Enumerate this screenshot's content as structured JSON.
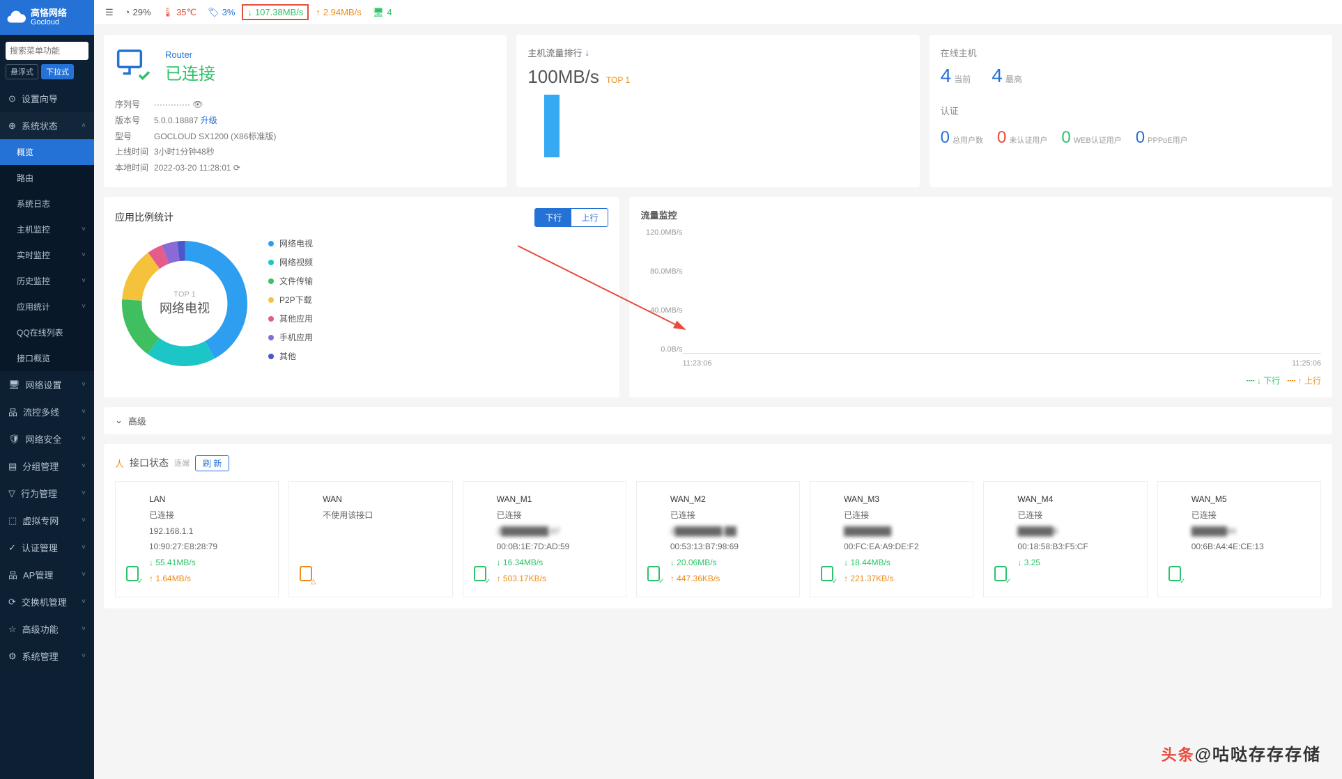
{
  "brand": {
    "name": "高恪网络",
    "sub": "Gocloud"
  },
  "search": {
    "placeholder": "搜索菜单功能"
  },
  "modes": {
    "float": "悬浮式",
    "dropdown": "下拉式"
  },
  "menu": {
    "setup": "设置向导",
    "status": "系统状态",
    "status_sub": {
      "overview": "概览",
      "route": "路由",
      "log": "系统日志",
      "host": "主机监控",
      "realtime": "实时监控",
      "history": "历史监控",
      "app": "应用统计",
      "qq": "QQ在线列表",
      "iface": "接口概览"
    },
    "network": "网络设置",
    "flowctl": "流控多线",
    "security": "网络安全",
    "group": "分组管理",
    "behavior": "行为管理",
    "vpn": "虚拟专网",
    "auth": "认证管理",
    "ap": "AP管理",
    "switch": "交换机管理",
    "advanced": "高级功能",
    "system": "系统管理"
  },
  "topbar": {
    "cpu": "29%",
    "temp": "35℃",
    "mem": "3%",
    "down": "107.38MB/s",
    "up": "2.94MB/s",
    "hosts": "4"
  },
  "router": {
    "label": "Router",
    "status": "已连接",
    "serial_k": "序列号",
    "serial_v": "·············",
    "ver_k": "版本号",
    "ver_v": "5.0.0.18887",
    "upgrade": "升级",
    "model_k": "型号",
    "model_v": "GOCLOUD SX1200 (X86标准版)",
    "uptime_k": "上线时间",
    "uptime_v": "3小时1分钟48秒",
    "local_k": "本地时间",
    "local_v": "2022-03-20 11:28:01"
  },
  "traffic": {
    "title": "主机流量排行",
    "value": "100MB/s",
    "top": "TOP 1"
  },
  "hosts": {
    "title": "在线主机",
    "now": "4",
    "now_t": "当前",
    "max": "4",
    "max_t": "最高",
    "auth_title": "认证",
    "items": [
      {
        "n": "0",
        "t": "总用户数",
        "c": "blue"
      },
      {
        "n": "0",
        "t": "未认证用户",
        "c": "red"
      },
      {
        "n": "0",
        "t": "WEB认证用户",
        "c": "green"
      },
      {
        "n": "0",
        "t": "PPPoE用户",
        "c": "blue"
      }
    ]
  },
  "appstats": {
    "title": "应用比例统计",
    "tab_down": "下行",
    "tab_up": "上行",
    "center_top": "TOP 1",
    "center_name": "网络电视",
    "legend": [
      {
        "c": "#2e9ef0",
        "t": "网络电视"
      },
      {
        "c": "#1cc6c6",
        "t": "网络视频"
      },
      {
        "c": "#3fbf5f",
        "t": "文件传输"
      },
      {
        "c": "#f5c33b",
        "t": "P2P下载"
      },
      {
        "c": "#e55b8a",
        "t": "其他应用"
      },
      {
        "c": "#8a6bd6",
        "t": "手机应用"
      },
      {
        "c": "#4a56c9",
        "t": "其他"
      }
    ]
  },
  "flow": {
    "title": "流量监控",
    "y": [
      "120.0MB/s",
      "80.0MB/s",
      "40.0MB/s",
      "0.0B/s"
    ],
    "x": [
      "11:23:06",
      "11:25:06"
    ],
    "legend_down": "下行",
    "legend_up": "上行"
  },
  "adv": {
    "title": "高级"
  },
  "iface": {
    "title": "接口状态",
    "sub": "逐端",
    "refresh": "刷 新",
    "cards": [
      {
        "name": "LAN",
        "status": "已连接",
        "ip": "192.168.1.1",
        "mac": "10:90:27:E8:28:79",
        "down": "55.41MB/s",
        "up": "1.64MB/s",
        "ok": true
      },
      {
        "name": "WAN",
        "status": "不使用该接口",
        "ok": false
      },
      {
        "name": "WAN_M1",
        "status": "已连接",
        "ip": "2████████.87",
        "mac": "00:0B:1E:7D:AD:59",
        "down": "16.34MB/s",
        "up": "503.17KB/s",
        "ok": true,
        "blur": true
      },
      {
        "name": "WAN_M2",
        "status": "已连接",
        "ip": "2████████.██",
        "mac": "00:53:13:B7:98:69",
        "down": "20.06MB/s",
        "up": "447.36KB/s",
        "ok": true,
        "blur": true
      },
      {
        "name": "WAN_M3",
        "status": "已连接",
        "ip": "████████",
        "mac": "00:FC:EA:A9:DE:F2",
        "down": "18.44MB/s",
        "up": "221.37KB/s",
        "ok": true,
        "blur": true
      },
      {
        "name": "WAN_M4",
        "status": "已连接",
        "ip": "██████8",
        "mac": "00:18:58:B3:F5:CF",
        "down": "3.25",
        "up": "",
        "ok": true,
        "blur": true
      },
      {
        "name": "WAN_M5",
        "status": "已连接",
        "ip": "██████84",
        "mac": "00:6B:A4:4E:CE:13",
        "down": "",
        "up": "",
        "ok": true,
        "blur": true
      }
    ]
  },
  "watermark": {
    "pre": "头条",
    "txt": "@咕哒存存存储"
  },
  "chart_data": {
    "donut": {
      "type": "pie",
      "title": "应用比例统计 · 下行",
      "center_label": "TOP 1 网络电视",
      "series": [
        {
          "name": "网络电视",
          "value": 42,
          "color": "#2e9ef0"
        },
        {
          "name": "网络视频",
          "value": 18,
          "color": "#1cc6c6"
        },
        {
          "name": "文件传输",
          "value": 16,
          "color": "#3fbf5f"
        },
        {
          "name": "P2P下载",
          "value": 14,
          "color": "#f5c33b"
        },
        {
          "name": "其他应用",
          "value": 4,
          "color": "#e55b8a"
        },
        {
          "name": "手机应用",
          "value": 4,
          "color": "#8a6bd6"
        },
        {
          "name": "其他",
          "value": 2,
          "color": "#4a56c9"
        }
      ]
    },
    "flow": {
      "type": "line",
      "title": "流量监控",
      "ylabel": "",
      "ylim": [
        0,
        120
      ],
      "yunit": "MB/s",
      "x": [
        "11:23:06",
        "11:25:06"
      ],
      "series": [
        {
          "name": "下行",
          "color": "#2dc26b",
          "values": [
            0,
            0
          ]
        },
        {
          "name": "上行",
          "color": "#ec8d1c",
          "values": [
            0,
            0
          ]
        }
      ]
    },
    "traffic_bar": {
      "type": "bar",
      "title": "主机流量排行",
      "categories": [
        "TOP 1"
      ],
      "values": [
        100
      ],
      "yunit": "MB/s"
    }
  }
}
